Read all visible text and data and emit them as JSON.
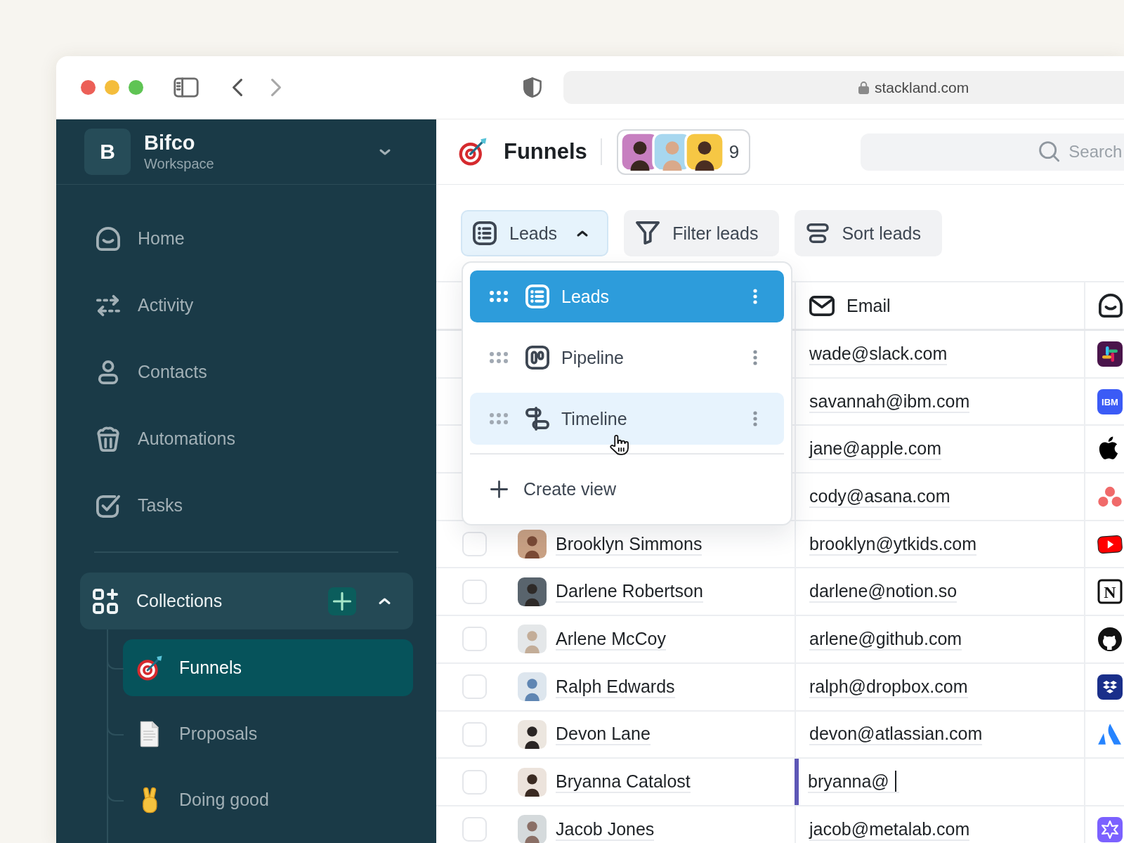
{
  "browser": {
    "url": "stackland.com"
  },
  "sidebar": {
    "workspace": {
      "initial": "B",
      "name": "Bifco",
      "subtitle": "Workspace"
    },
    "nav": [
      {
        "label": "Home"
      },
      {
        "label": "Activity"
      },
      {
        "label": "Contacts"
      },
      {
        "label": "Automations"
      },
      {
        "label": "Tasks"
      }
    ],
    "collections": {
      "label": "Collections",
      "expanded": true,
      "items": [
        {
          "label": "Funnels",
          "selected": true
        },
        {
          "label": "Proposals",
          "selected": false
        },
        {
          "label": "Doing good",
          "selected": false
        }
      ]
    }
  },
  "header": {
    "title": "Funnels",
    "member_count": "9",
    "search": {
      "placeholder": "Search"
    }
  },
  "toolbar": {
    "view": {
      "label": "Leads",
      "expanded": true
    },
    "buttons": [
      {
        "label": "Filter leads"
      },
      {
        "label": "Sort leads"
      }
    ]
  },
  "view_menu": {
    "items": [
      {
        "label": "Leads",
        "selected": true,
        "hovered": false
      },
      {
        "label": "Pipeline",
        "selected": false,
        "hovered": false
      },
      {
        "label": "Timeline",
        "selected": false,
        "hovered": true
      }
    ],
    "create_label": "Create view"
  },
  "table": {
    "columns": [
      {
        "label": "Email"
      }
    ],
    "rows": [
      {
        "email": "wade@slack.com",
        "editing": false
      },
      {
        "email": "savannah@ibm.com",
        "editing": false,
        "logo_text": "IBM"
      },
      {
        "email": "jane@apple.com",
        "editing": false
      },
      {
        "email": "cody@asana.com",
        "editing": false
      },
      {
        "name": "Brooklyn Simmons",
        "checked": false,
        "email": "brooklyn@ytkids.com",
        "editing": false
      },
      {
        "name": "Darlene Robertson",
        "checked": false,
        "email": "darlene@notion.so",
        "editing": false,
        "logo_text": "N"
      },
      {
        "name": "Arlene McCoy",
        "checked": false,
        "email": "arlene@github.com",
        "editing": false
      },
      {
        "name": "Ralph Edwards",
        "checked": false,
        "email": "ralph@dropbox.com",
        "editing": false
      },
      {
        "name": "Devon Lane",
        "checked": false,
        "email": "devon@atlassian.com",
        "editing": false
      },
      {
        "name": "Bryanna Catalost",
        "checked": false,
        "email": "bryanna@",
        "editing": true
      },
      {
        "name": "Jacob Jones",
        "checked": false,
        "email": "jacob@metalab.com",
        "editing": false
      }
    ]
  }
}
